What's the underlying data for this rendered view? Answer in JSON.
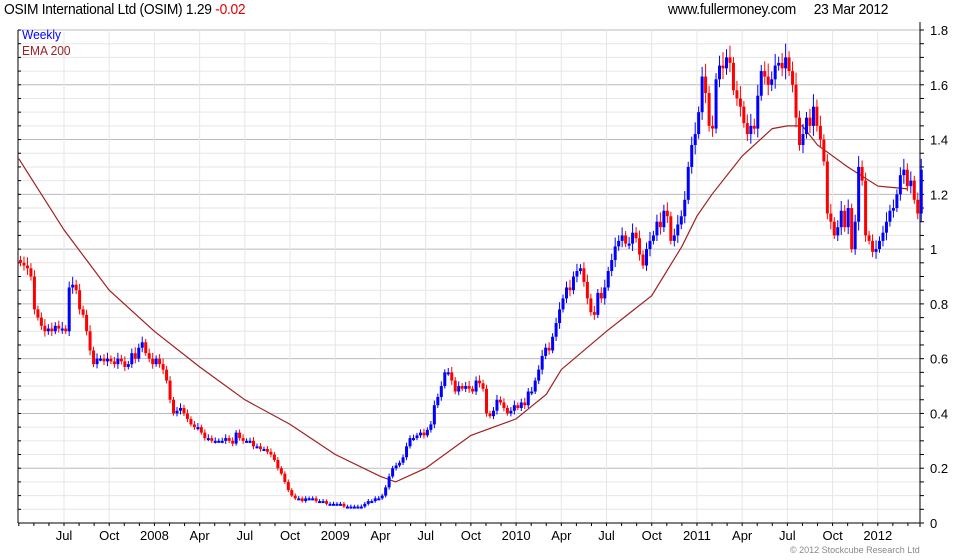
{
  "header": {
    "title": "OSIM International Ltd (OSIM) 1.29",
    "change": "-0.02",
    "site": "www.fullermoney.com",
    "date": "23 Mar 2012"
  },
  "footer": {
    "copyright": "© 2012 Stockcube Research Ltd"
  },
  "colors": {
    "up": "#0000ff",
    "down": "#ff0000",
    "ema": "#a02020",
    "grid_major": "#bbbbbb",
    "grid_minor": "#e6e6e6"
  },
  "chart_data": {
    "type": "candlestick",
    "title": "OSIM International Ltd (OSIM)",
    "legend": [
      {
        "name": "Weekly",
        "color": "#0000ff"
      },
      {
        "name": "EMA 200",
        "color": "#a02020"
      }
    ],
    "legend_placement": "top-left",
    "ylim": [
      0,
      1.8
    ],
    "y_ticks": [
      "0",
      "0.2",
      "0.4",
      "0.6",
      "0.8",
      "1",
      "1.2",
      "1.4",
      "1.6",
      "1.8"
    ],
    "x_ticks": [
      "Jul",
      "Oct",
      "2008",
      "Apr",
      "Jul",
      "Oct",
      "2009",
      "Apr",
      "Jul",
      "Oct",
      "2010",
      "Apr",
      "Jul",
      "Oct",
      "2011",
      "Apr",
      "Jul",
      "Oct",
      "2012"
    ],
    "grid": true,
    "weekly_close_by_quarter": {
      "2007-Q2": [
        0.95,
        0.94,
        0.93,
        0.9,
        0.78,
        0.75,
        0.72,
        0.7,
        0.71,
        0.7,
        0.72,
        0.71,
        0.71
      ],
      "2007-Q3": [
        0.7,
        0.86,
        0.87,
        0.85,
        0.78,
        0.76,
        0.7,
        0.63,
        0.58,
        0.6,
        0.6,
        0.59,
        0.6
      ],
      "2007-Q4": [
        0.59,
        0.58,
        0.6,
        0.59,
        0.57,
        0.58,
        0.62,
        0.6,
        0.64,
        0.66,
        0.62,
        0.6,
        0.58
      ],
      "2008-Q1": [
        0.6,
        0.58,
        0.56,
        0.52,
        0.45,
        0.4,
        0.41,
        0.42,
        0.4,
        0.38,
        0.36,
        0.35,
        0.35
      ],
      "2008-Q2": [
        0.33,
        0.31,
        0.31,
        0.3,
        0.3,
        0.3,
        0.3,
        0.31,
        0.3,
        0.29,
        0.33,
        0.31,
        0.3
      ],
      "2008-Q3": [
        0.3,
        0.3,
        0.28,
        0.28,
        0.27,
        0.27,
        0.26,
        0.25,
        0.23,
        0.2,
        0.18,
        0.15,
        0.12
      ],
      "2008-Q4": [
        0.1,
        0.09,
        0.09,
        0.08,
        0.09,
        0.09,
        0.09,
        0.08,
        0.08,
        0.08,
        0.07,
        0.07,
        0.07
      ],
      "2009-Q1": [
        0.07,
        0.07,
        0.06,
        0.06,
        0.06,
        0.06,
        0.06,
        0.06,
        0.07,
        0.08,
        0.08,
        0.09,
        0.09
      ],
      "2009-Q2": [
        0.1,
        0.13,
        0.17,
        0.2,
        0.21,
        0.22,
        0.24,
        0.28,
        0.31,
        0.31,
        0.32,
        0.33,
        0.32
      ],
      "2009-Q3": [
        0.34,
        0.36,
        0.43,
        0.46,
        0.5,
        0.55,
        0.55,
        0.52,
        0.48,
        0.5,
        0.49,
        0.5,
        0.49
      ],
      "2009-Q4": [
        0.48,
        0.52,
        0.51,
        0.49,
        0.4,
        0.39,
        0.41,
        0.45,
        0.44,
        0.42,
        0.4,
        0.41,
        0.43
      ],
      "2010-Q1": [
        0.42,
        0.44,
        0.43,
        0.48,
        0.48,
        0.52,
        0.56,
        0.61,
        0.64,
        0.63,
        0.68,
        0.73,
        0.78
      ],
      "2010-Q2": [
        0.82,
        0.86,
        0.85,
        0.9,
        0.92,
        0.93,
        0.88,
        0.82,
        0.77,
        0.76,
        0.84,
        0.82,
        0.86
      ],
      "2010-Q3": [
        0.92,
        0.96,
        1.01,
        1.03,
        1.05,
        1.02,
        1.02,
        1.06,
        1.04,
        0.98,
        0.94,
        1.0,
        1.03
      ],
      "2010-Q4": [
        1.05,
        1.1,
        1.08,
        1.14,
        1.12,
        1.03,
        1.05,
        1.09,
        1.12,
        1.18,
        1.3,
        1.38,
        1.42
      ],
      "2011-Q1": [
        1.5,
        1.63,
        1.57,
        1.45,
        1.44,
        1.62,
        1.67,
        1.66,
        1.7,
        1.68,
        1.58,
        1.55,
        1.52
      ],
      "2011-Q2": [
        1.46,
        1.42,
        1.45,
        1.44,
        1.56,
        1.65,
        1.63,
        1.6,
        1.62,
        1.67,
        1.68,
        1.66,
        1.7
      ],
      "2011-Q3": [
        1.65,
        1.6,
        1.48,
        1.38,
        1.42,
        1.48,
        1.45,
        1.52,
        1.45,
        1.4,
        1.32,
        1.13,
        1.1
      ],
      "2011-Q4": [
        1.05,
        1.08,
        1.14,
        1.08,
        1.15,
        1.0,
        1.1,
        1.3,
        1.25,
        1.05,
        1.03,
        0.99,
        1.0
      ],
      "2012-Q1": [
        1.03,
        1.06,
        1.1,
        1.14,
        1.15,
        1.2,
        1.27,
        1.29,
        1.23,
        1.25,
        1.18,
        1.13,
        1.29
      ]
    },
    "ema200": [
      [
        "2007-04",
        1.33
      ],
      [
        "2007-07",
        1.07
      ],
      [
        "2007-10",
        0.85
      ],
      [
        "2008-01",
        0.7
      ],
      [
        "2008-04",
        0.57
      ],
      [
        "2008-07",
        0.45
      ],
      [
        "2008-10",
        0.36
      ],
      [
        "2009-01",
        0.25
      ],
      [
        "2009-04",
        0.17
      ],
      [
        "2009-05",
        0.15
      ],
      [
        "2009-07",
        0.2
      ],
      [
        "2009-10",
        0.32
      ],
      [
        "2010-01",
        0.38
      ],
      [
        "2010-03",
        0.47
      ],
      [
        "2010-04",
        0.56
      ],
      [
        "2010-07",
        0.7
      ],
      [
        "2010-10",
        0.83
      ],
      [
        "2010-12",
        1.01
      ],
      [
        "2011-01",
        1.12
      ],
      [
        "2011-02",
        1.2
      ],
      [
        "2011-04",
        1.34
      ],
      [
        "2011-06",
        1.44
      ],
      [
        "2011-07",
        1.45
      ],
      [
        "2011-08",
        1.45
      ],
      [
        "2011-09",
        1.38
      ],
      [
        "2011-11",
        1.3
      ],
      [
        "2012-01",
        1.23
      ],
      [
        "2012-03",
        1.22
      ]
    ]
  }
}
